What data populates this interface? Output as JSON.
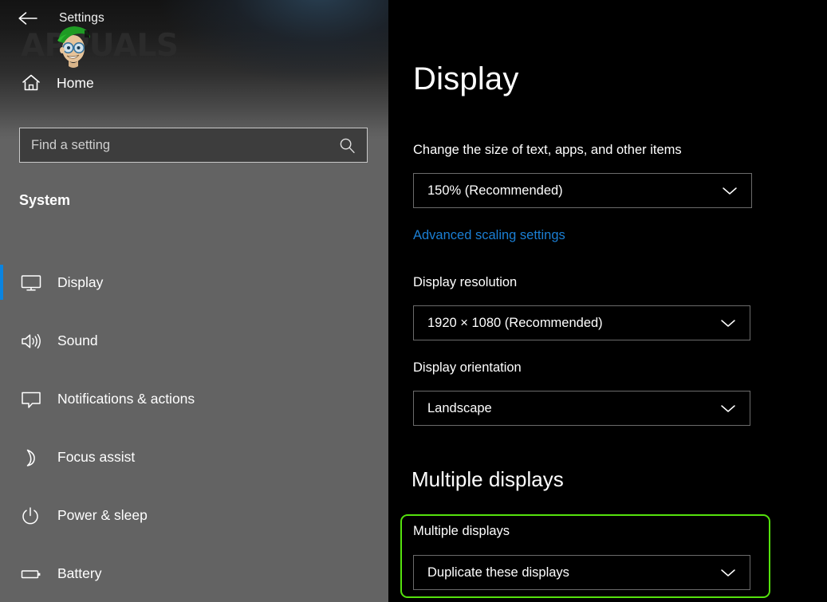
{
  "window": {
    "title": "Settings",
    "back_icon": "back-arrow-icon"
  },
  "watermark": {
    "text": "APPUALS",
    "text_before_face": "A",
    "text_after_face": "PUALS"
  },
  "sidebar": {
    "home": {
      "label": "Home",
      "icon": "home-icon"
    },
    "search": {
      "placeholder": "Find a setting",
      "value": "",
      "icon": "search-icon"
    },
    "section_title": "System",
    "accent_color": "#0a84e0",
    "items": [
      {
        "label": "Display",
        "icon": "monitor-icon",
        "selected": true
      },
      {
        "label": "Sound",
        "icon": "speaker-icon",
        "selected": false
      },
      {
        "label": "Notifications & actions",
        "icon": "chat-bubble-icon",
        "selected": false
      },
      {
        "label": "Focus assist",
        "icon": "crescent-moon-icon",
        "selected": false
      },
      {
        "label": "Power & sleep",
        "icon": "power-icon",
        "selected": false
      },
      {
        "label": "Battery",
        "icon": "battery-icon",
        "selected": false
      }
    ]
  },
  "main": {
    "page_title": "Display",
    "scale": {
      "label": "Change the size of text, apps, and other items",
      "value": "150% (Recommended)",
      "chevron_icon": "chevron-down-icon"
    },
    "advanced_link": {
      "label": "Advanced scaling settings",
      "color": "#1b7fd4"
    },
    "resolution": {
      "label": "Display resolution",
      "value": "1920 × 1080 (Recommended)",
      "chevron_icon": "chevron-down-icon"
    },
    "orientation": {
      "label": "Display orientation",
      "value": "Landscape",
      "chevron_icon": "chevron-down-icon"
    },
    "multiple_displays": {
      "heading": "Multiple displays",
      "label": "Multiple displays",
      "value": "Duplicate these displays",
      "chevron_icon": "chevron-down-icon",
      "highlight_color": "#55e10d"
    }
  }
}
